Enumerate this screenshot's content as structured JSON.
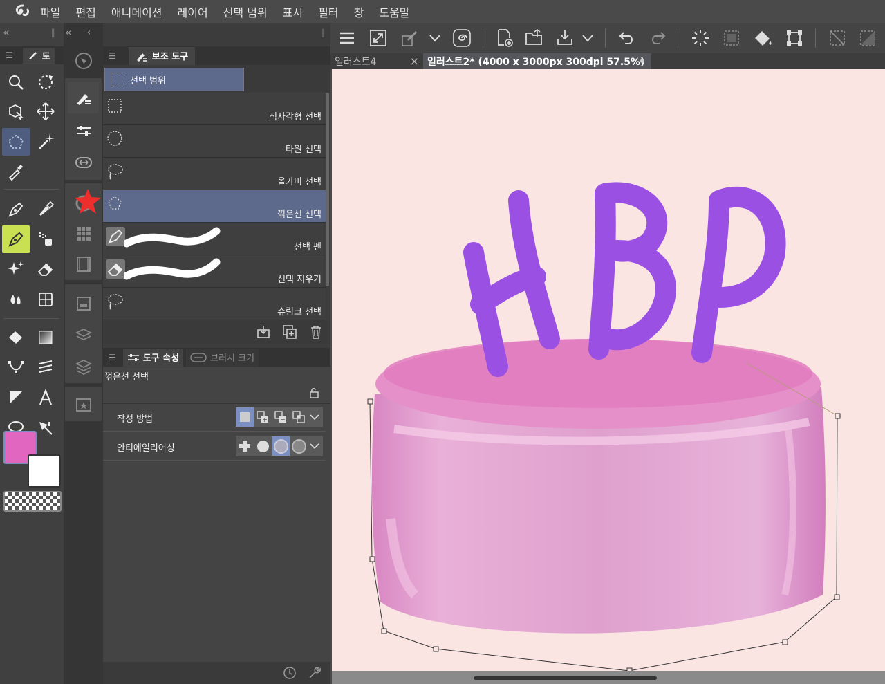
{
  "menubar": {
    "items": [
      "파일",
      "편집",
      "애니메이션",
      "레이어",
      "선택 범위",
      "표시",
      "필터",
      "창",
      "도움말"
    ]
  },
  "tool_panel": {
    "tab_label": "도"
  },
  "subtool_panel": {
    "title": "보조 도구",
    "group_label": "선택 범위",
    "items": [
      {
        "label": "직사각형 선택",
        "icon": "rect-select-icon"
      },
      {
        "label": "타원 선택",
        "icon": "ellipse-select-icon"
      },
      {
        "label": "올가미 선택",
        "icon": "lasso-select-icon"
      },
      {
        "label": "꺾은선 선택",
        "icon": "polyline-select-icon",
        "selected": true
      },
      {
        "label": "선택 펜",
        "icon": "selection-pen-icon"
      },
      {
        "label": "선택 지우기",
        "icon": "selection-eraser-icon"
      },
      {
        "label": "슈링크 선택",
        "icon": "shrink-select-icon"
      }
    ]
  },
  "tool_property": {
    "tab1": "도구 속성",
    "tab2": "브러시 크기",
    "tool_name": "꺾은선 선택",
    "rows": [
      {
        "label": "작성 방법"
      },
      {
        "label": "안티에일리어싱"
      }
    ]
  },
  "canvas_tabs": [
    {
      "label": "일러스트4",
      "active": false
    },
    {
      "label": "일러스트2* (4000 x 3000px 300dpi 57.5%)",
      "active": true
    }
  ],
  "colors": {
    "main": "#e066c0",
    "sub": "#ffffff",
    "accent": "#4e5d80",
    "canvas": "#fae5e3"
  },
  "artwork": {
    "text": "HBP"
  }
}
